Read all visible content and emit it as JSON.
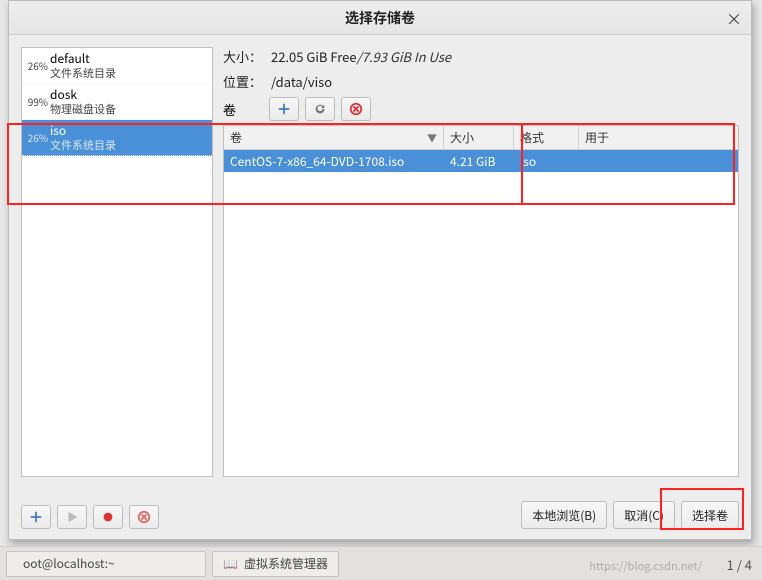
{
  "window": {
    "title": "选择存储卷",
    "close_glyph": "×"
  },
  "pools": {
    "items": [
      {
        "pct": "26%",
        "name": "default",
        "sub": "文件系统目录"
      },
      {
        "pct": "99%",
        "name": "dosk",
        "sub": "物理磁盘设备"
      },
      {
        "pct": "26%",
        "name": "iso",
        "sub": "文件系统目录"
      }
    ],
    "selected_index": 2
  },
  "info": {
    "size_label": "大小：",
    "size_value_free": "22.05 GiB Free",
    "size_sep": " / ",
    "size_value_used": "7.93 GiB In Use",
    "loc_label": "位置：",
    "loc_value": "/data/viso",
    "vol_toolbar_label": "卷"
  },
  "vol_header": {
    "col0": "卷",
    "col1": "大小",
    "col2": "格式",
    "col3": "用于",
    "sort_glyph": "▼"
  },
  "vol_rows": [
    {
      "name": "CentOS-7-x86_64-DVD-1708.iso",
      "size": "4.21 GiB",
      "format": "iso",
      "used": ""
    }
  ],
  "buttons": {
    "browse": "本地浏览(B)",
    "cancel": "取消(C)",
    "choose": "选择卷"
  },
  "taskbar": {
    "item1": "oot@localhost:~",
    "item2": "虚拟系统管理器",
    "page": "1 / 4",
    "watermark": "https://blog.csdn.net/"
  }
}
